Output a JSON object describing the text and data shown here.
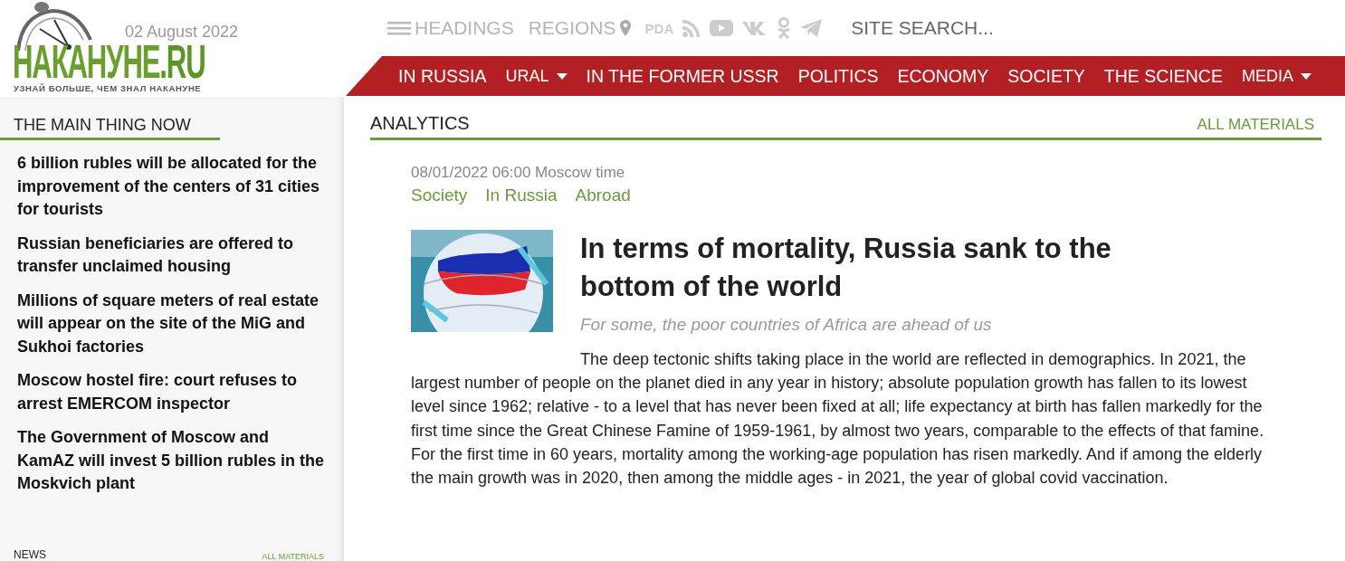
{
  "header": {
    "date": "02 August 2022",
    "logo": {
      "name": "НАКАНУНЕ",
      "suffix": ".RU",
      "tagline": "УЗНАЙ БОЛЬШЕ, ЧЕМ ЗНАЛ НАКАНУНЕ"
    },
    "top_links": [
      {
        "label": "HEADINGS",
        "kind": "menu"
      },
      {
        "label": "REGIONS",
        "kind": "pin"
      }
    ],
    "pda": "PDA",
    "social": [
      {
        "kind": "rss"
      },
      {
        "kind": "youtube"
      },
      {
        "kind": "vk"
      },
      {
        "kind": "ok"
      },
      {
        "kind": "telegram"
      }
    ],
    "search": {
      "placeholder": "SITE SEARCH..."
    },
    "nav": [
      {
        "label": "IN RUSSIA",
        "dropdown": false
      },
      {
        "label": "URAL",
        "dropdown": true
      },
      {
        "label": "IN THE FORMER USSR",
        "dropdown": false
      },
      {
        "label": "POLITICS",
        "dropdown": false
      },
      {
        "label": "ECONOMY",
        "dropdown": false
      },
      {
        "label": "SOCIETY",
        "dropdown": false
      },
      {
        "label": "THE SCIENCE",
        "dropdown": false
      },
      {
        "label": "MEDIA",
        "dropdown": true
      }
    ]
  },
  "sidebar": {
    "title": "THE MAIN THING NOW",
    "items": [
      "6 billion rubles will be allocated for the improvement of the centers of 31 cities for tourists",
      "Russian beneficiaries are offered to transfer unclaimed housing",
      "Millions of square meters of real estate will appear on the site of the MiG and Sukhoi factories",
      "Moscow hostel fire: court refuses to arrest EMERCOM inspector",
      "The Government of Moscow and KamAZ will invest 5 billion rubles in the Moskvich plant"
    ],
    "news": {
      "title": "NEWS",
      "link": "ALL MATERIALS"
    }
  },
  "main": {
    "section": "ANALYTICS",
    "link": "ALL MATERIALS",
    "article": {
      "datetime": "08/01/2022 06:00 Moscow time",
      "tags": [
        "Society",
        "In Russia",
        "Abroad"
      ],
      "title": "In terms of mortality, Russia sank to the bottom of the world",
      "subtitle": "For some, the poor countries of Africa are ahead of us",
      "body": "The deep tectonic shifts taking place in the world are reflected in demographics. In 2021, the largest number of people on the planet died in any year in history; absolute population growth has fallen to its lowest level since 1962; relative - to a level that has never been fixed at all; life expectancy at birth has fallen markedly for the first time since the Great Chinese Famine of 1959-1961, by almost two years, comparable to the effects of that famine. For the first time in 60 years, mortality among the working-age population has risen markedly. And if among the elderly the main growth was in 2020, then among the middle ages - in 2021, the year of global covid vaccination."
    }
  }
}
